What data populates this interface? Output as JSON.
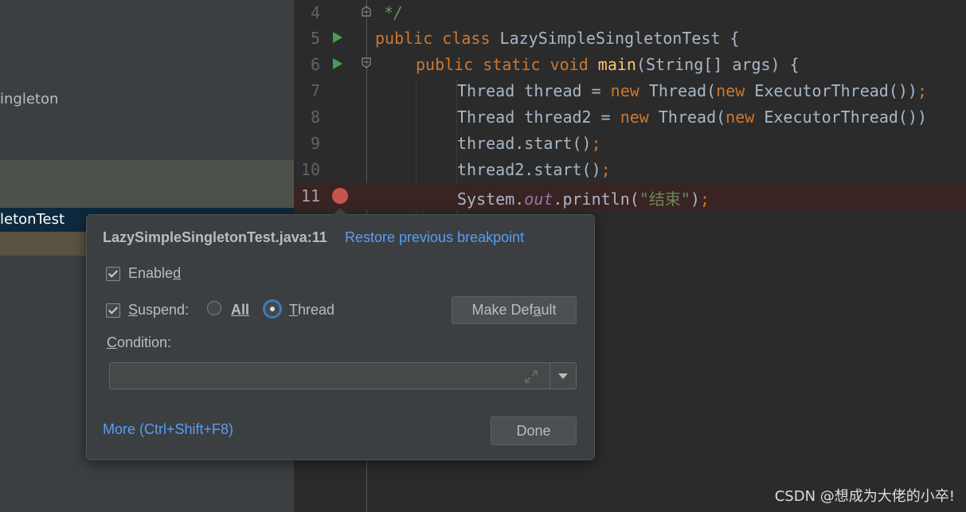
{
  "project_tree": {
    "items": [
      "ingleton",
      "letonTest"
    ]
  },
  "editor": {
    "lines": [
      {
        "num": "4"
      },
      {
        "num": "5"
      },
      {
        "num": "6"
      },
      {
        "num": "7"
      },
      {
        "num": "8"
      },
      {
        "num": "9"
      },
      {
        "num": "10"
      },
      {
        "num": "11"
      }
    ],
    "code": {
      "l4_comment": "*/",
      "l5_kw": "public class ",
      "l5_name": "LazySimpleSingletonTest {",
      "l6_kw": "public static void ",
      "l6_fn": "main",
      "l6_rest": "(String[] args) {",
      "l7_a": "Thread thread = ",
      "l7_new1": "new",
      "l7_b": " Thread(",
      "l7_new2": "new",
      "l7_c": " ExecutorThread())",
      "l7_semi": ";",
      "l8_a": "Thread thread2 = ",
      "l8_new1": "new",
      "l8_b": " Thread(",
      "l8_new2": "new",
      "l8_c": " ExecutorThread())",
      "l9_a": "thread.start()",
      "l9_semi": ";",
      "l10_a": "thread2.start()",
      "l10_semi": ";",
      "l11_a": "System.",
      "l11_out": "out",
      "l11_b": ".println(",
      "l11_str": "\"结束\"",
      "l11_c": ")",
      "l11_semi": ";"
    }
  },
  "popup": {
    "title": "LazySimpleSingletonTest.java:11",
    "restore_link": "Restore previous breakpoint",
    "enabled_label_pre": "Enable",
    "enabled_label_u": "d",
    "suspend_label_u": "S",
    "suspend_label_rest": "uspend:",
    "radio_all": "All",
    "radio_thread_u": "T",
    "radio_thread_rest": "hread",
    "make_default_pre": "Make Def",
    "make_default_u": "a",
    "make_default_post": "ult",
    "condition_u": "C",
    "condition_rest": "ondition:",
    "condition_value": "",
    "more_link": "More (Ctrl+Shift+F8)",
    "done_button": "Done",
    "enabled": true,
    "suspend": true,
    "suspend_mode": "Thread"
  },
  "watermark": "CSDN @想成为大佬的小卒!",
  "colors": {
    "keyword": "#cc7832",
    "function": "#ffc66d",
    "string": "#6a8759",
    "link": "#589df6",
    "breakpoint": "#c75450"
  }
}
